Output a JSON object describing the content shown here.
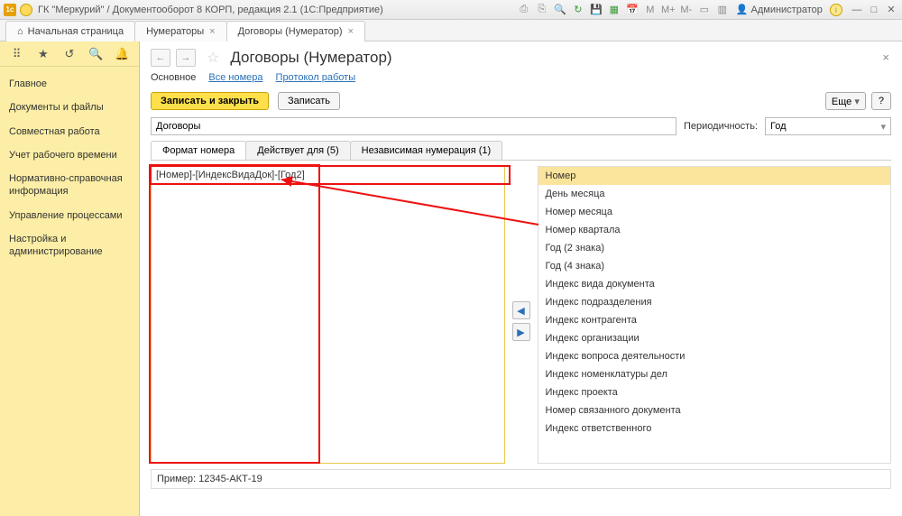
{
  "titlebar": {
    "title": "ГК \"Меркурий\" / Документооборот 8 КОРП, редакция 2.1  (1С:Предприятие)",
    "user": "Администратор"
  },
  "tabs": {
    "home": "Начальная страница",
    "t1": "Нумераторы",
    "t2": "Договоры (Нумератор)"
  },
  "sidebar": {
    "items": [
      "Главное",
      "Документы и файлы",
      "Совместная работа",
      "Учет рабочего времени",
      "Нормативно-справочная информация",
      "Управление процессами",
      "Настройка и администрирование"
    ]
  },
  "page": {
    "title": "Договоры (Нумератор)",
    "subtabs": {
      "main": "Основное",
      "all": "Все номера",
      "proto": "Протокол работы"
    },
    "actions": {
      "saveClose": "Записать и закрыть",
      "save": "Записать",
      "more": "Еще",
      "help": "?"
    },
    "nameValue": "Договоры",
    "period": {
      "label": "Периодичность:",
      "value": "Год"
    },
    "innerTabs": {
      "format": "Формат номера",
      "active": "Действует для (5)",
      "indep": "Независимая нумерация (1)"
    },
    "formatValue": "[Номер]-[ИндексВидаДок]-[Год2]",
    "options": [
      "Номер",
      "День месяца",
      "Номер месяца",
      "Номер квартала",
      "Год (2 знака)",
      "Год (4 знака)",
      "Индекс вида документа",
      "Индекс подразделения",
      "Индекс контрагента",
      "Индекс организации",
      "Индекс вопроса деятельности",
      "Индекс номенклатуры дел",
      "Индекс проекта",
      "Номер связанного документа",
      "Индекс ответственного"
    ],
    "exampleLabel": "Пример:",
    "exampleValue": "12345-АКТ-19"
  }
}
